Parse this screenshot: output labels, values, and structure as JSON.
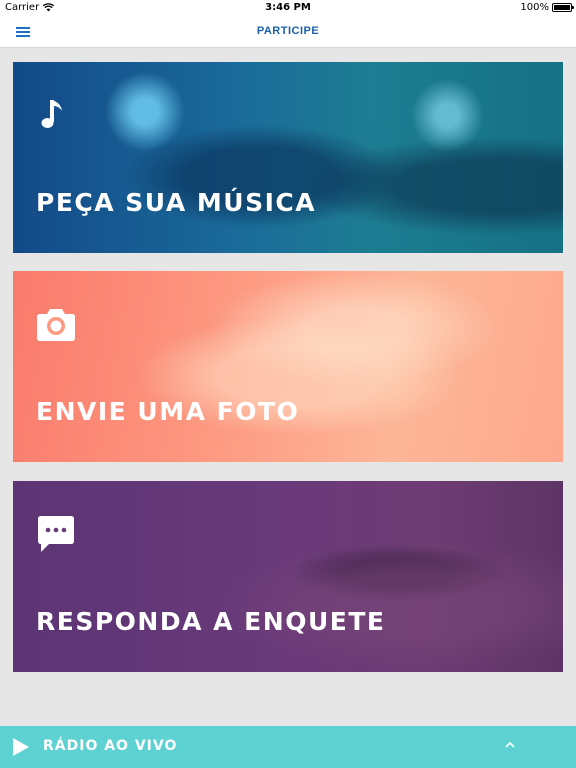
{
  "status_bar": {
    "carrier": "Carrier",
    "time": "3:46 PM",
    "battery": "100%",
    "wifi_icon": "wifi-icon",
    "battery_icon": "battery-icon"
  },
  "nav": {
    "title": "PARTICIPE",
    "menu_icon": "hamburger-menu-icon",
    "accent_color": "#1a5fa8"
  },
  "cards": [
    {
      "id": "music",
      "label": "PEÇA SUA MÚSICA",
      "icon": "music-note-icon",
      "color": "#1a6a9a"
    },
    {
      "id": "photo",
      "label": "ENVIE UMA FOTO",
      "icon": "camera-icon",
      "color": "#fd9a82"
    },
    {
      "id": "poll",
      "label": "RESPONDA A ENQUETE",
      "icon": "chat-bubble-icon",
      "color": "#6a3a7a"
    }
  ],
  "player": {
    "label": "RÁDIO AO VIVO",
    "play_icon": "play-icon",
    "expand_icon": "chevron-up-icon",
    "color": "#5ed1d3"
  }
}
